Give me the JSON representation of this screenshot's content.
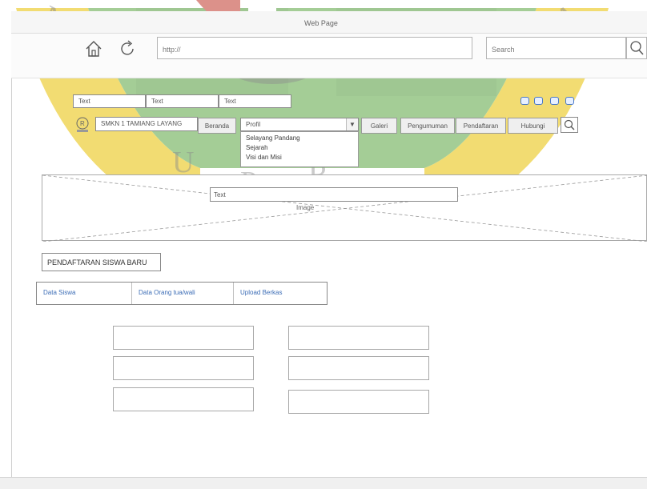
{
  "window": {
    "title": "Web Page"
  },
  "toolbar": {
    "home_icon": "home-icon",
    "reload_icon": "reload-icon",
    "url": "http://",
    "search_placeholder": "Search",
    "search_icon": "search-icon"
  },
  "top_texts": [
    "Text",
    "Text",
    "Text"
  ],
  "logo": {
    "name": "SMKN 1 TAMIANG LAYANG"
  },
  "nav": {
    "beranda": "Beranda",
    "profil_selected": "Profil",
    "profil_options": [
      "Selayang Pandang",
      "Sejarah",
      "Visi dan Misi"
    ],
    "galeri": "Galeri",
    "pengumuman": "Pengumuman",
    "pendaftaran": "Pendaftaran",
    "hubungi": "Hubungi"
  },
  "banner": {
    "text": "Text",
    "image_label": "Image"
  },
  "registration": {
    "title": "PENDAFTARAN SISWA BARU",
    "tabs": [
      "Data Siswa",
      "Data Orang tua/wali",
      "Upload Berkas"
    ]
  },
  "colors": {
    "link": "#3c6db6",
    "watermark_green": "#4a9a3a",
    "watermark_yellow": "#e6b800",
    "watermark_red": "#c0392b"
  }
}
